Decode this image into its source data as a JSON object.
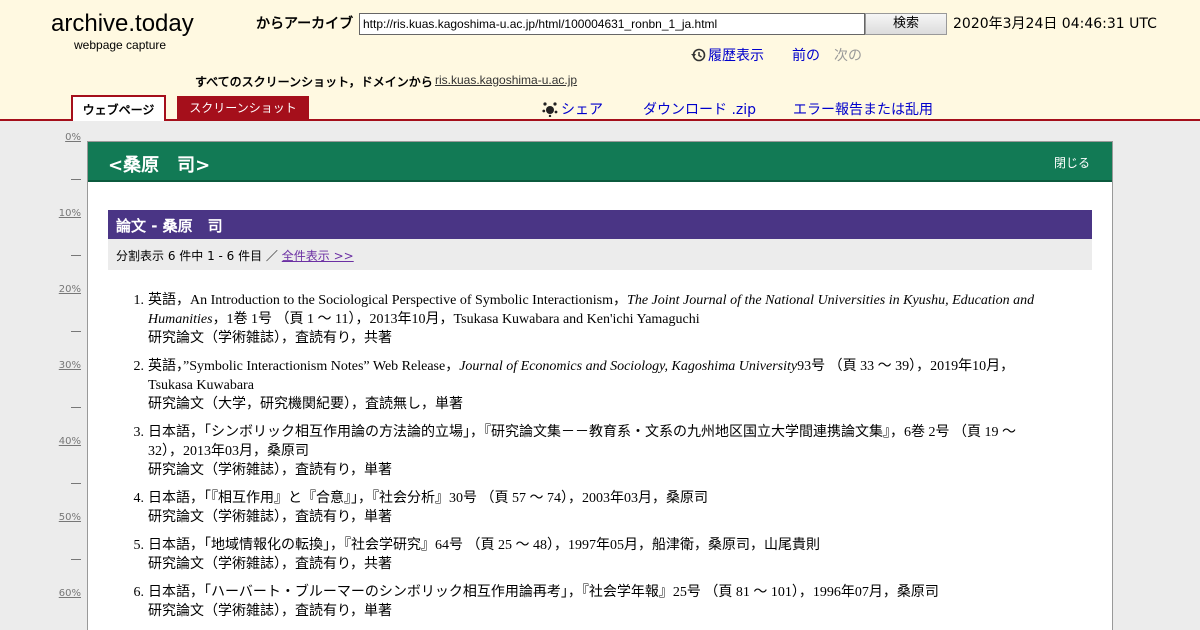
{
  "header": {
    "logo_title": "archive.today",
    "logo_sub": "webpage capture",
    "archive_label": "からアーカイブ",
    "url_value": "http://ris.kuas.kagoshima-u.ac.jp/html/100004631_ronbn_1_ja.html",
    "search_label": "検索",
    "date": "2020年3月24日 04:46:31 UTC",
    "history_label": "履歴表示",
    "prev_label": "前の",
    "next_label": "次の",
    "all_screenshots": "すべてのスクリーンショット，ドメインから",
    "domain": "ris.kuas.kagoshima-u.ac.jp",
    "tab_webpage": "ウェブページ",
    "tab_screenshot": "スクリーンショット",
    "share_label": "シェア",
    "download_label": "ダウンロード .zip",
    "report_label": "エラー報告または乱用"
  },
  "ruler": [
    "0%",
    "10%",
    "20%",
    "30%",
    "40%",
    "50%",
    "60%"
  ],
  "page": {
    "title": "<桑原　司>",
    "close_label": "閉じる",
    "section_title": "論文 - 桑原　司",
    "paging_text": "分割表示  6 件中 1 - 6 件目 ／ ",
    "show_all_label": "全件表示 >>"
  },
  "papers": [
    {
      "num": "1.",
      "pre": "英語，An Introduction to the Sociological Perspective of Symbolic Interactionism，",
      "journal": "The Joint Journal of the National Universities in Kyushu, Education and Humanities",
      "post": "，1巻 1号 （頁 1 ～ 11），2013年10月，Tsukasa Kuwabara and Ken'ichi Yamaguchi",
      "type": "研究論文（学術雑誌），査読有り，共著"
    },
    {
      "num": "2.",
      "pre": "英語，”Symbolic Interactionism Notes” Web Release，",
      "journal": "Journal of Economics and Sociology, Kagoshima University",
      "post": "93号 （頁 33 ～ 39），2019年10月，Tsukasa Kuwabara",
      "type": "研究論文（大学，研究機関紀要），査読無し，単著"
    },
    {
      "num": "3.",
      "pre": "日本語，「シンボリック相互作用論の方法論的立場」，『研究論文集－－教育系・文系の九州地区国立大学間連携論文集』，6巻 2号 （頁 19 ～ 32），2013年03月，桑原司",
      "journal": "",
      "post": "",
      "type": "研究論文（学術雑誌），査読有り，単著"
    },
    {
      "num": "4.",
      "pre": "日本語，「『相互作用』と『合意』」，『社会分析』30号 （頁 57 ～ 74），2003年03月，桑原司",
      "journal": "",
      "post": "",
      "type": "研究論文（学術雑誌），査読有り，単著"
    },
    {
      "num": "5.",
      "pre": "日本語，「地域情報化の転換」，『社会学研究』64号 （頁 25 ～ 48），1997年05月，船津衛，桑原司，山尾貴則",
      "journal": "",
      "post": "",
      "type": "研究論文（学術雑誌），査読有り，共著"
    },
    {
      "num": "6.",
      "pre": "日本語，「ハーバート・ブルーマーのシンボリック相互作用論再考」，『社会学年報』25号 （頁 81 ～ 101），1996年07月，桑原司",
      "journal": "",
      "post": "",
      "type": "研究論文（学術雑誌），査読有り，単著"
    }
  ]
}
